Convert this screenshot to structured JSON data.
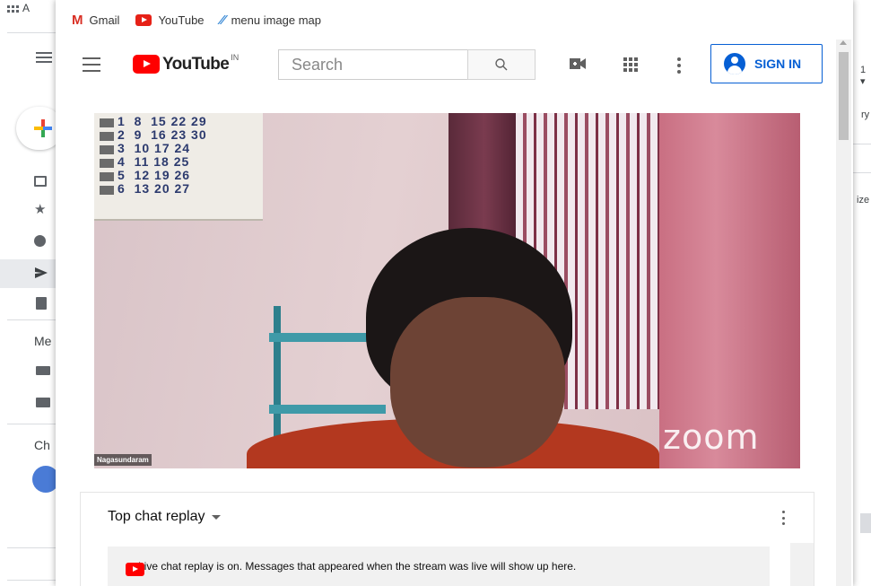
{
  "browser_bookmarks": [
    {
      "label": "Gmail",
      "icon": "gmail-icon"
    },
    {
      "label": "YouTube",
      "icon": "youtube-icon"
    },
    {
      "label": "menu image map",
      "icon": "map-icon"
    }
  ],
  "background": {
    "apps_partial": "A",
    "meet_label_partial": "Me",
    "chat_label_partial": "Ch",
    "right_partial_1": "1 ▾",
    "right_partial_2": "ry",
    "right_partial_3": "ize"
  },
  "youtube": {
    "logo_text": "YouTube",
    "logo_region": "IN",
    "search_placeholder": "Search",
    "sign_in_label": "SIGN IN",
    "accent_color": "#ff0000",
    "link_color": "#065fd4"
  },
  "video": {
    "participant_name": "Nagasundaram",
    "watermark": "zoom",
    "calendar_numbers": "1  8  15 22 29\n2  9  16 23 30\n3  10 17 24\n4  11 18 25\n5  12 19 26\n6  13 20 27"
  },
  "chat": {
    "title": "Top chat replay",
    "replay_notice": "Live chat replay is on. Messages that appeared when the stream was live will show up here."
  }
}
